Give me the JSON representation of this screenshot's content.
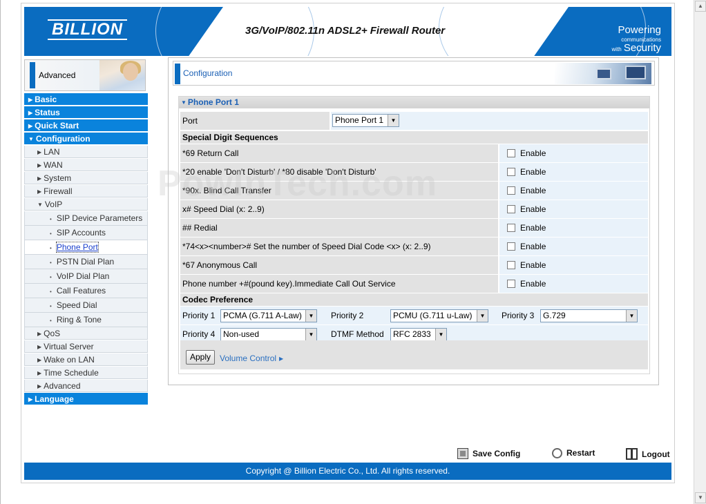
{
  "banner": {
    "logo": "BILLION",
    "product_title": "3G/VoIP/802.11n ADSL2+ Firewall Router",
    "slogan_line1_big": "Powering",
    "slogan_line1_small": "communications",
    "slogan_line2_small": "with",
    "slogan_line2_big": "Security"
  },
  "sidebar_header": {
    "label": "Advanced"
  },
  "menu": {
    "basic": "Basic",
    "status": "Status",
    "quick_start": "Quick Start",
    "configuration": "Configuration",
    "lan": "LAN",
    "wan": "WAN",
    "system": "System",
    "firewall": "Firewall",
    "voip": "VoIP",
    "sip_device_parameters": "SIP Device Parameters",
    "sip_accounts": "SIP Accounts",
    "phone_port": "Phone Port",
    "pstn_dial_plan": "PSTN Dial Plan",
    "voip_dial_plan": "VoIP Dial Plan",
    "call_features": "Call Features",
    "speed_dial": "Speed Dial",
    "ring_tone": "Ring & Tone",
    "qos": "QoS",
    "virtual_server": "Virtual Server",
    "wake_on_lan": "Wake on LAN",
    "time_schedule": "Time Schedule",
    "advanced": "Advanced",
    "language": "Language"
  },
  "content": {
    "title": "Configuration",
    "section_title": "Phone Port 1",
    "port_label": "Port",
    "port_value": "Phone Port 1",
    "special_digits_title": "Special Digit Sequences",
    "enable_label": "Enable",
    "sequences": [
      "*69 Return Call",
      "*20 enable 'Don't Disturb' / *80 disable 'Don't Disturb'",
      "*90x. Blind Call Transfer",
      "x# Speed Dial (x: 2..9)",
      "## Redial",
      "*74<x><number>#  Set the number of Speed Dial Code <x> (x: 2..9)",
      "*67 Anonymous Call",
      "Phone number +#(pound key).Immediate Call Out Service"
    ],
    "codec_title": "Codec Preference",
    "priority1_label": "Priority 1",
    "priority1_value": "PCMA (G.711 A-Law)",
    "priority2_label": "Priority 2",
    "priority2_value": "PCMU (G.711 u-Law)",
    "priority3_label": "Priority 3",
    "priority3_value": "G.729",
    "priority4_label": "Priority 4",
    "priority4_value": "Non-used",
    "dtmf_label": "DTMF Method",
    "dtmf_value": "RFC 2833",
    "apply_label": "Apply",
    "volume_link": "Volume Control"
  },
  "footer": {
    "save_config": "Save Config",
    "restart": "Restart",
    "logout": "Logout",
    "copyright": "Copyright @ Billion Electric Co., Ltd. All rights reserved."
  },
  "watermark": "PowInTech.com"
}
